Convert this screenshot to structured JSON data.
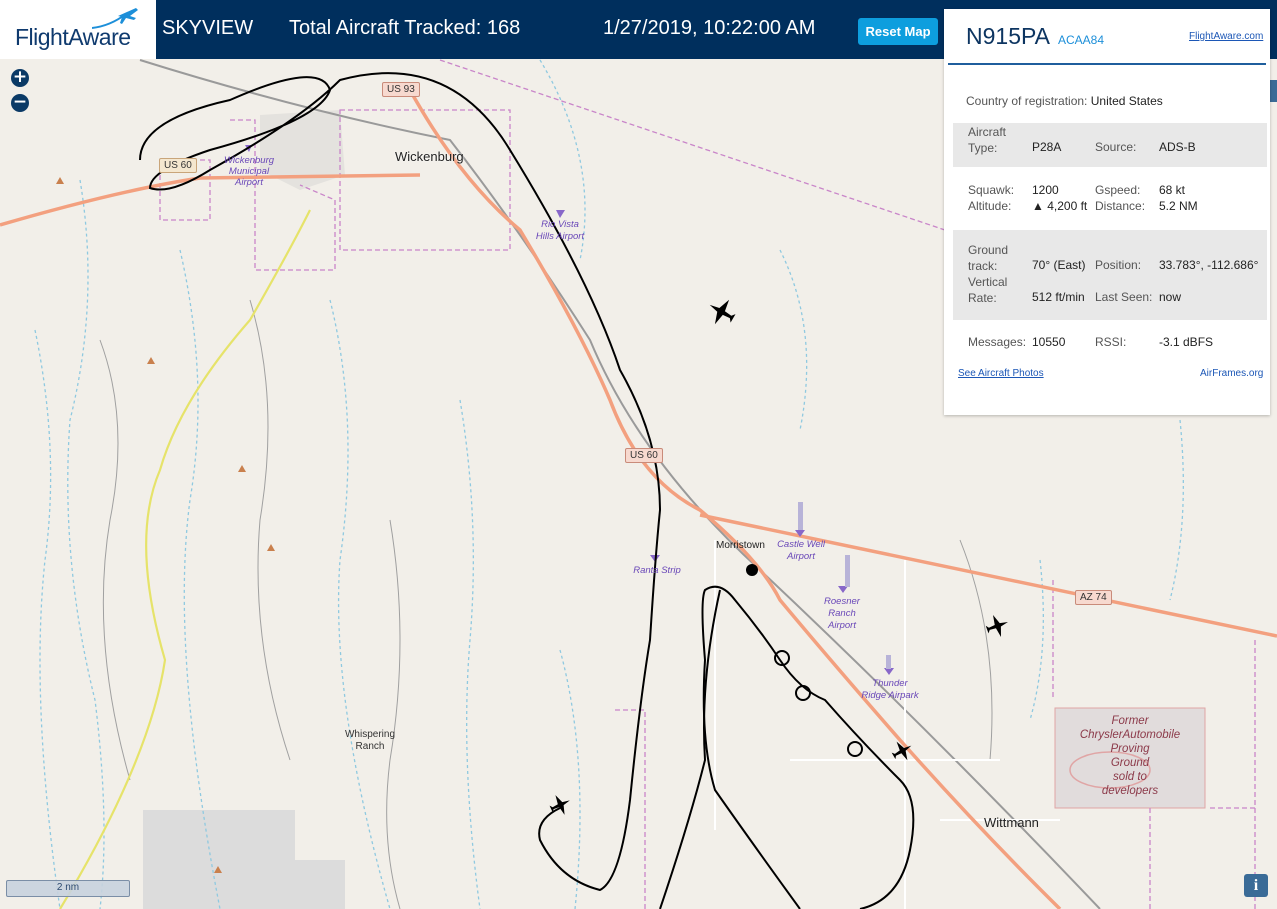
{
  "header": {
    "logo_text": "FlightAware",
    "app_name": "SKYVIEW",
    "total_tracked": "Total Aircraft Tracked: 168",
    "datetime": "1/27/2019, 10:22:00 AM",
    "reset_label": "Reset Map"
  },
  "map": {
    "zoom_in": "+",
    "zoom_out": "−",
    "scale": "2 nm",
    "info": "i",
    "road_labels": [
      "US 93",
      "US 60",
      "US 60",
      "AZ 74"
    ],
    "place_labels": [
      "Wickenburg",
      "Morristown",
      "Wittmann"
    ],
    "ranch_label": [
      "Whispering",
      "Ranch"
    ],
    "airports": {
      "wickenburg": [
        "Wickenburg",
        "Municipal",
        "Airport"
      ],
      "rio_vista": [
        "Rio Vista",
        "Hills Airport"
      ],
      "castle_well": [
        "Castle Well",
        "Airport"
      ],
      "ranta": [
        "Ranta Strip"
      ],
      "roesner": [
        "Roesner",
        "Ranch",
        "Airport"
      ],
      "thunder": [
        "Thunder",
        "Ridge Airpark"
      ]
    },
    "proving_ground": [
      "Former",
      "ChryslerAutomobile",
      "Proving",
      "Ground",
      "sold to",
      "developers"
    ]
  },
  "panel": {
    "registration": "N915PA",
    "hex": "ACAA84",
    "flightaware_link": "FlightAware.com",
    "country_label": "Country of registration:",
    "country_value": "United States",
    "aircraft_type_label": "Aircraft",
    "aircraft_type_label2": "Type:",
    "aircraft_type": "P28A",
    "source_label": "Source:",
    "source": "ADS-B",
    "squawk_label": "Squawk:",
    "squawk": "1200",
    "gspeed_label": "Gspeed:",
    "gspeed": "68 kt",
    "altitude_label": "Altitude:",
    "altitude": "▲ 4,200 ft",
    "distance_label": "Distance:",
    "distance": "5.2 NM",
    "ground_track_label1": "Ground",
    "ground_track_label2": "track:",
    "ground_track": "70° (East)",
    "position_label": "Position:",
    "position": "33.783°, -112.686°",
    "vrate_label1": "Vertical",
    "vrate_label2": "Rate:",
    "vrate": "512 ft/min",
    "last_seen_label": "Last Seen:",
    "last_seen": "now",
    "messages_label": "Messages:",
    "messages": "10550",
    "rssi_label": "RSSI:",
    "rssi": "-3.1 dBFS",
    "photos_link": "See Aircraft Photos",
    "airframes_link": "AirFrames.org"
  },
  "colors": {
    "header_bg": "#002f5d",
    "reset_btn": "#0d9ede",
    "major_road": "#f3a07f",
    "boundary": "#c985c9",
    "water": "#8fc9e0",
    "airport": "#8867c9"
  }
}
